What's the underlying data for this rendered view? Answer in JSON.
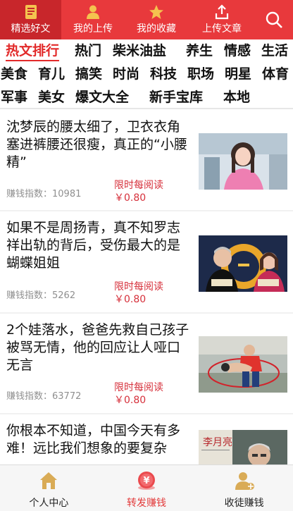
{
  "top_tabs": [
    {
      "label": "精选好文",
      "icon": "article-icon",
      "active": true
    },
    {
      "label": "我的上传",
      "icon": "person-icon",
      "active": false
    },
    {
      "label": "我的收藏",
      "icon": "star-icon",
      "active": false
    },
    {
      "label": "上传文章",
      "icon": "upload-icon",
      "active": false
    }
  ],
  "search_icon": "search-icon",
  "categories": [
    "热文排行",
    "热门",
    "柴米油盐",
    "养生",
    "情感",
    "生活",
    "美食",
    "育儿",
    "搞笑",
    "时尚",
    "科技",
    "职场",
    "明星",
    "体育",
    "军事",
    "美女",
    "爆文大全",
    "新手宝库",
    "本地"
  ],
  "active_category": "热文排行",
  "articles": [
    {
      "title": "沈梦辰的腰太细了，卫衣衣角塞进裤腰还很瘦，真正的“小腰精”",
      "score_label": "赚钱指数：",
      "score": "10981",
      "reward_label": "限时每阅读",
      "reward": "￥0.80"
    },
    {
      "title": "如果不是周扬青，真不知罗志祥出轨的背后，受伤最大的是蝴蝶姐姐",
      "score_label": "赚钱指数：",
      "score": "5262",
      "reward_label": "限时每阅读",
      "reward": "￥0.80"
    },
    {
      "title": "2个娃落水，爸爸先救自己孩子被骂无情，他的回应让人哑口无言",
      "score_label": "赚钱指数：",
      "score": "63772",
      "reward_label": "限时每阅读",
      "reward": "￥0.80"
    },
    {
      "title": "你根本不知道，中国今天有多难！远比我们想象的要复杂",
      "score_label": "",
      "score": "",
      "reward_label": "",
      "reward": "",
      "thumb_caption": "李月亮"
    }
  ],
  "bottom_tabs": [
    {
      "label": "个人中心",
      "icon": "home-icon",
      "active": false
    },
    {
      "label": "转发赚钱",
      "icon": "yuan-coin-icon",
      "active": true
    },
    {
      "label": "收徒赚钱",
      "icon": "recruit-user-icon",
      "active": false
    }
  ],
  "colors": {
    "brand_red": "#e8393c",
    "active_tab": "#c8262b",
    "reward_red": "#d6303b",
    "category_active": "#e22a2a"
  }
}
